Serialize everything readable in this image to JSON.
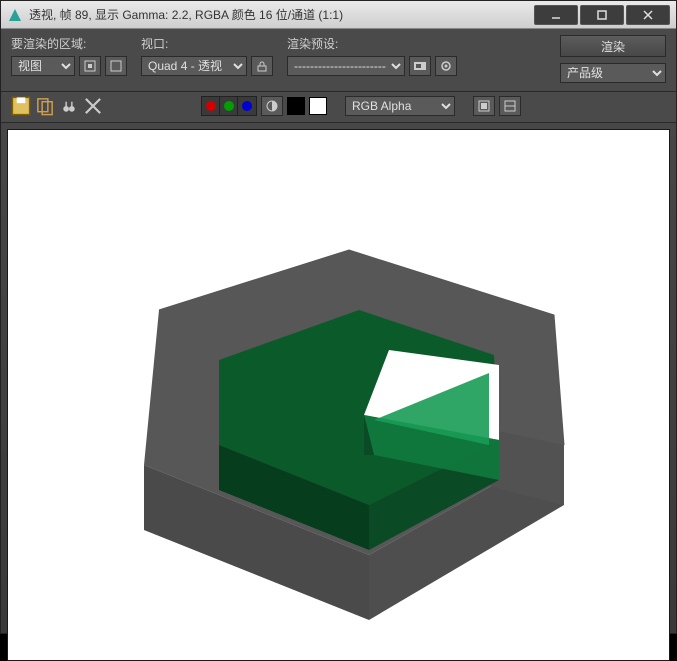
{
  "window": {
    "title": "透视, 帧 89, 显示 Gamma: 2.2, RGBA 颜色 16 位/通道 (1:1)"
  },
  "toolbar": {
    "area_label": "要渲染的区域:",
    "area_value": "视图",
    "viewport_label": "视口:",
    "viewport_value": "Quad 4 - 透视",
    "preset_label": "渲染预设:",
    "preset_value": "------------------------",
    "render_btn": "渲染",
    "quality_value": "产品级"
  },
  "toolbar2": {
    "channel_value": "RGB Alpha"
  },
  "colors": {
    "red": "#d40000",
    "green": "#00a000",
    "blue": "#0000d4",
    "white": "#ffffff",
    "black": "#000000"
  }
}
